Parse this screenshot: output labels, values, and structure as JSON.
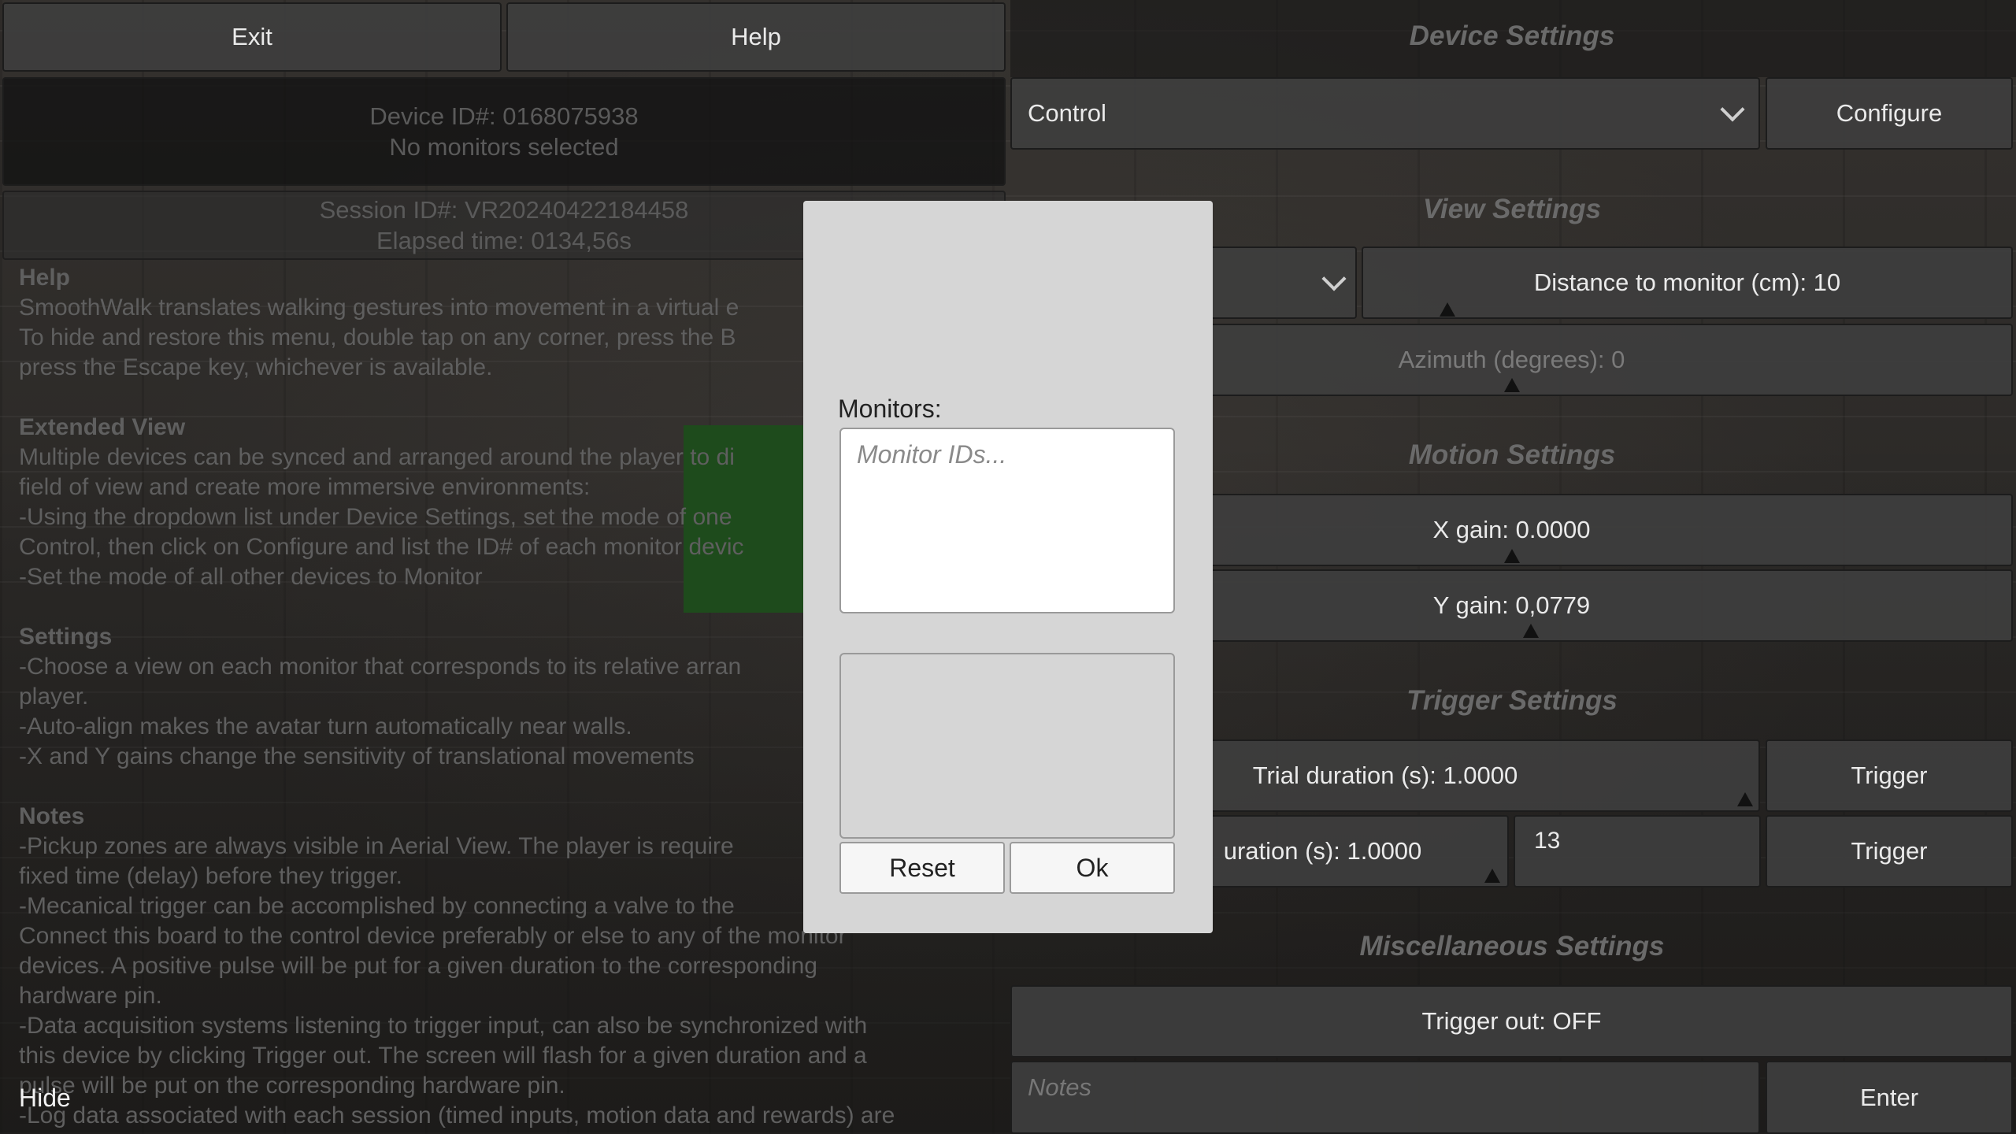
{
  "top_buttons": {
    "exit": "Exit",
    "help": "Help"
  },
  "device_panel": {
    "device_id": "Device ID#: 0168075938",
    "monitors_status": "No monitors selected"
  },
  "session_panel": {
    "session_id": "Session ID#: VR20240422184458",
    "elapsed": "Elapsed time: 0134,56s"
  },
  "help_text": {
    "help_heading": "Help",
    "help_lines": [
      "SmoothWalk translates walking gestures into movement in a virtual e",
      "To hide and restore this menu, double tap on any corner, press the B",
      "press the Escape key, whichever is available."
    ],
    "extended_heading": "Extended View",
    "extended_lines": [
      "Multiple devices can be synced and arranged around the player to di",
      "field of view and create more immersive environments:",
      "-Using the dropdown list under Device Settings, set the mode of one",
      "Control, then click on Configure and list the ID# of each monitor devic",
      "-Set the mode of all other devices to Monitor"
    ],
    "settings_heading": "Settings",
    "settings_lines": [
      "-Choose a view on each monitor that corresponds to its relative arran",
      "player.",
      "-Auto-align makes the avatar turn automatically near walls.",
      "-X and Y gains change the sensitivity of translational movements"
    ],
    "notes_heading": "Notes",
    "notes_lines": [
      "-Pickup zones are always visible in Aerial View. The player is require",
      "fixed time (delay) before they trigger.",
      "-Mecanical trigger can be accomplished by connecting a valve to the",
      "Connect this board to the control device preferably or else to any of the monitor",
      "devices. A positive pulse will be put for a given duration to the corresponding",
      "hardware pin.",
      "-Data acquisition systems listening to trigger input, can also be synchronized with",
      "this device by clicking Trigger out. The screen will flash for a given duration and a",
      "pulse will be put on the corresponding hardware pin.",
      "-Log data associated with each session (timed inputs, motion data and rewards) are"
    ]
  },
  "hide_label": "Hide",
  "device_settings": {
    "title": "Device Settings",
    "mode_selected": "Control",
    "configure": "Configure"
  },
  "view_settings": {
    "title": "View Settings",
    "distance": "Distance to monitor (cm): 10",
    "azimuth": "Azimuth (degrees): 0"
  },
  "motion_settings": {
    "title": "Motion Settings",
    "x_gain": "X gain: 0.0000",
    "y_gain": "Y gain: 0,0779"
  },
  "trigger_settings": {
    "title": "Trigger Settings",
    "trial_duration": "Trial duration (s): 1.0000",
    "trigger_1": "Trigger",
    "second_duration": "uration (s): 1.0000",
    "pin_value": "13",
    "trigger_2": "Trigger"
  },
  "misc_settings": {
    "title": "Miscellaneous Settings",
    "trigger_out": "Trigger out: OFF",
    "notes_placeholder": "Notes",
    "enter": "Enter"
  },
  "modal": {
    "label": "Monitors:",
    "input_placeholder": "Monitor IDs...",
    "reset": "Reset",
    "ok": "Ok"
  },
  "colors": {
    "modal_bg": "#d6d6d6",
    "button_bg": "#3e3e3e",
    "green_block": "#1e4b1c"
  }
}
